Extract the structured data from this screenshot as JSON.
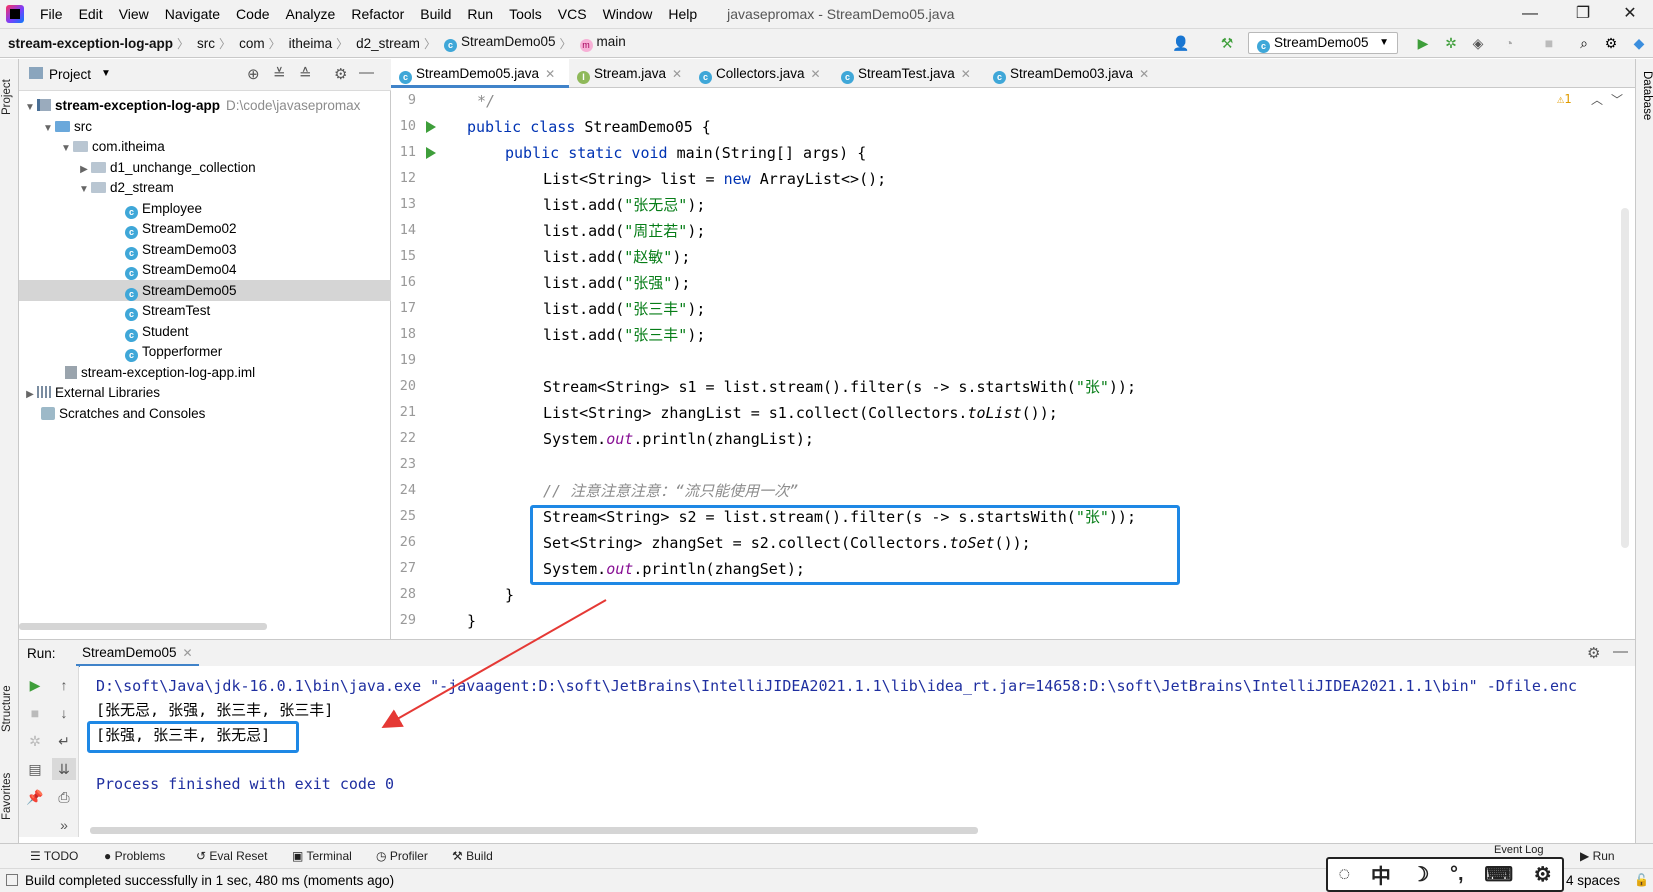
{
  "menu": {
    "items": [
      "File",
      "Edit",
      "View",
      "Navigate",
      "Code",
      "Analyze",
      "Refactor",
      "Build",
      "Run",
      "Tools",
      "VCS",
      "Window",
      "Help"
    ],
    "window_title": "javasepromax - StreamDemo05.java"
  },
  "breadcrumbs": [
    "stream-exception-log-app",
    "src",
    "com",
    "itheima",
    "d2_stream",
    "StreamDemo05",
    "main"
  ],
  "run_config": {
    "selected": "StreamDemo05"
  },
  "left_strip": {
    "project_tab": "Project",
    "structure_tab": "Structure",
    "favorites_tab": "Favorites"
  },
  "right_strip": {
    "database_tab": "Database"
  },
  "project": {
    "header": "Project",
    "root_name": "stream-exception-log-app",
    "root_path": "D:\\code\\javasepromax",
    "src": "src",
    "package": "com.itheima",
    "folder_d1": "d1_unchange_collection",
    "folder_d2": "d2_stream",
    "classes": [
      "Employee",
      "StreamDemo02",
      "StreamDemo03",
      "StreamDemo04",
      "StreamDemo05",
      "StreamTest",
      "Student",
      "Topperformer"
    ],
    "iml": "stream-exception-log-app.iml",
    "external_libraries": "External Libraries",
    "scratches": "Scratches and Consoles"
  },
  "editor_tabs": [
    "StreamDemo05.java",
    "Stream.java",
    "Collectors.java",
    "StreamTest.java",
    "StreamDemo03.java"
  ],
  "editor": {
    "warning_count": "1",
    "line_numbers": [
      "9",
      "10",
      "11",
      "12",
      "13",
      "14",
      "15",
      "16",
      "17",
      "18",
      "19",
      "20",
      "21",
      "22",
      "23",
      "24",
      "25",
      "26",
      "27",
      "28",
      "29"
    ],
    "lines": {
      "l9": "*/",
      "l10_kw": "public class ",
      "l10_rest": "StreamDemo05 {",
      "l11_kw": "public static void ",
      "l11_rest": "main(String[] args) {",
      "l12_a": "List<String> list = ",
      "l12_kw": "new ",
      "l12_b": "ArrayList<>();",
      "adds": [
        "\"张无忌\"",
        "\"周芷若\"",
        "\"赵敏\"",
        "\"张强\"",
        "\"张三丰\"",
        "\"张三丰\""
      ],
      "l20_a": "Stream<String> s1 = list.stream().filter(s -> s.startsWith(",
      "l20_str": "\"张\"",
      "l20_b": "));",
      "l21_a": "List<String> zhangList = s1.collect(Collectors.",
      "l21_it": "toList",
      "l21_b": "());",
      "l22_a": "System.",
      "l22_fld": "out",
      "l22_b": ".println(zhangList);",
      "l24": "// 注意注意注意：“流只能使用一次”",
      "l25_a": "Stream<String> s2 = list.stream().filter(s -> s.startsWith(",
      "l25_str": "\"张\"",
      "l25_b": "));",
      "l26_a": "Set<String> zhangSet = s2.collect(Collectors.",
      "l26_it": "toSet",
      "l26_b": "());",
      "l27_a": "System.",
      "l27_fld": "out",
      "l27_b": ".println(zhangSet);",
      "l28": "}",
      "l29": "}"
    }
  },
  "run": {
    "label": "Run:",
    "tab": "StreamDemo05",
    "console": [
      "D:\\soft\\Java\\jdk-16.0.1\\bin\\java.exe \"-javaagent:D:\\soft\\JetBrains\\IntelliJIDEA2021.1.1\\lib\\idea_rt.jar=14658:D:\\soft\\JetBrains\\IntelliJIDEA2021.1.1\\bin\" -Dfile.enc",
      "[张无忌, 张强, 张三丰, 张三丰]",
      "[张强, 张三丰, 张无忌]",
      "",
      "Process finished with exit code 0"
    ]
  },
  "bottom_tabs": [
    "TODO",
    "Problems",
    "Eval Reset",
    "Terminal",
    "Profiler",
    "Build"
  ],
  "bottom_right": {
    "event_log": "Event Log",
    "run": "Run"
  },
  "status": {
    "message": "Build completed successfully in 1 sec, 480 ms (moments ago)",
    "indent": "4 spaces"
  },
  "ime": {
    "lang": "中"
  },
  "colors": {
    "accent": "#1e88e5",
    "annotation_arrow": "#e53935",
    "keyword": "#0033b3",
    "string": "#067d17"
  }
}
